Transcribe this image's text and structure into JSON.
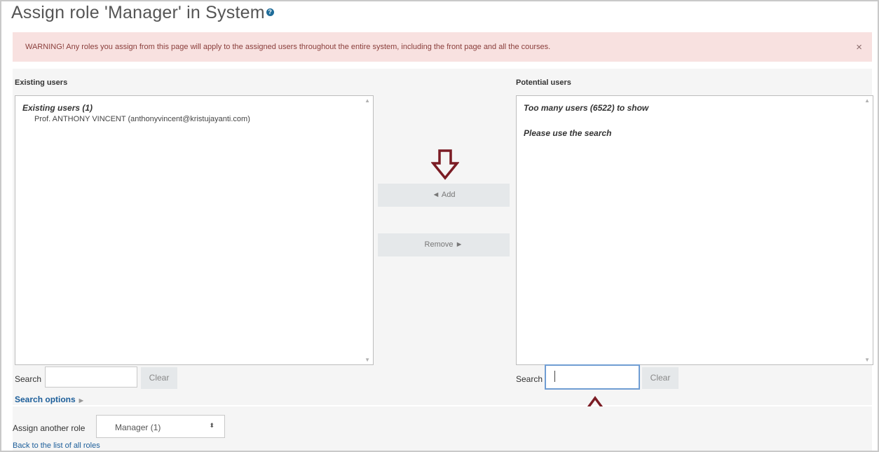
{
  "page": {
    "title": "Assign role 'Manager' in System",
    "help_icon": "question-circle-icon"
  },
  "warning": {
    "text": "WARNING! Any roles you assign from this page will apply to the assigned users throughout the entire system, including the front page and all the courses.",
    "close_glyph": "×"
  },
  "existing": {
    "heading": "Existing users",
    "group_label": "Existing users (1)",
    "options": [
      "Prof. ANTHONY VINCENT (anthonyvincent@kristujayanti.com)"
    ],
    "search_label": "Search",
    "search_value": "",
    "clear_label": "Clear"
  },
  "actions": {
    "add_label": "◄ Add",
    "remove_label": "Remove ►"
  },
  "potential": {
    "heading": "Potential users",
    "message_1": "Too many users (6522) to show",
    "message_2": "Please use the search",
    "search_label": "Search",
    "search_value": "",
    "clear_label": "Clear"
  },
  "search_options": {
    "label": "Search options",
    "toggle_glyph": "▶"
  },
  "assign_another": {
    "label": "Assign another role",
    "selected": "Manager (1)",
    "caret_glyph": "⬍"
  },
  "back_link": "Back to the list of all roles",
  "annotations": {
    "arrow_color": "#7b1c24"
  }
}
